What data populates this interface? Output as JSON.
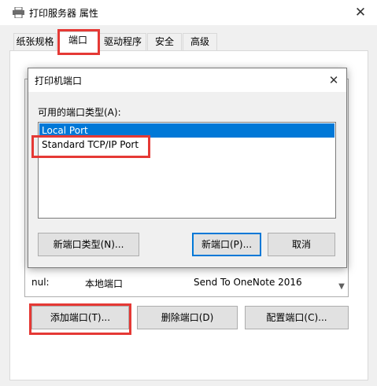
{
  "outer": {
    "title": "打印服务器 属性",
    "close_glyph": "✕",
    "tabs": [
      {
        "label": "纸张规格"
      },
      {
        "label": "端口"
      },
      {
        "label": "驱动程序"
      },
      {
        "label": "安全"
      },
      {
        "label": "高级"
      }
    ],
    "ports_visible": [
      {
        "port": "nul:",
        "description": "本地端口",
        "printer": "Send To OneNote 2016"
      }
    ],
    "buttons": {
      "add": "添加端口(T)...",
      "delete": "删除端口(D)",
      "configure": "配置端口(C)..."
    }
  },
  "inner": {
    "title": "打印机端口",
    "close_glyph": "✕",
    "label": "可用的端口类型(A):",
    "options": [
      "Local Port",
      "Standard TCP/IP Port"
    ],
    "buttons": {
      "new_type": "新端口类型(N)...",
      "new_port": "新端口(P)...",
      "cancel": "取消"
    }
  },
  "colors": {
    "accent": "#0078d7",
    "highlight": "#e53935"
  }
}
